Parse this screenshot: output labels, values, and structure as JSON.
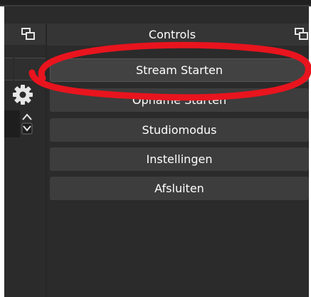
{
  "controls_dock": {
    "title": "Controls",
    "buttons": [
      {
        "label": "Stream Starten"
      },
      {
        "label": "Opname Starten"
      },
      {
        "label": "Studiomodus"
      },
      {
        "label": "Instellingen"
      },
      {
        "label": "Afsluiten"
      }
    ]
  },
  "icons": {
    "undock": "undock-icon",
    "settings": "gear-icon",
    "spin": "spin-arrows-icon"
  },
  "colors": {
    "panel_bg": "#2b2b2b",
    "button_bg": "#3d3d3d",
    "annotation_red": "#e8141e"
  }
}
